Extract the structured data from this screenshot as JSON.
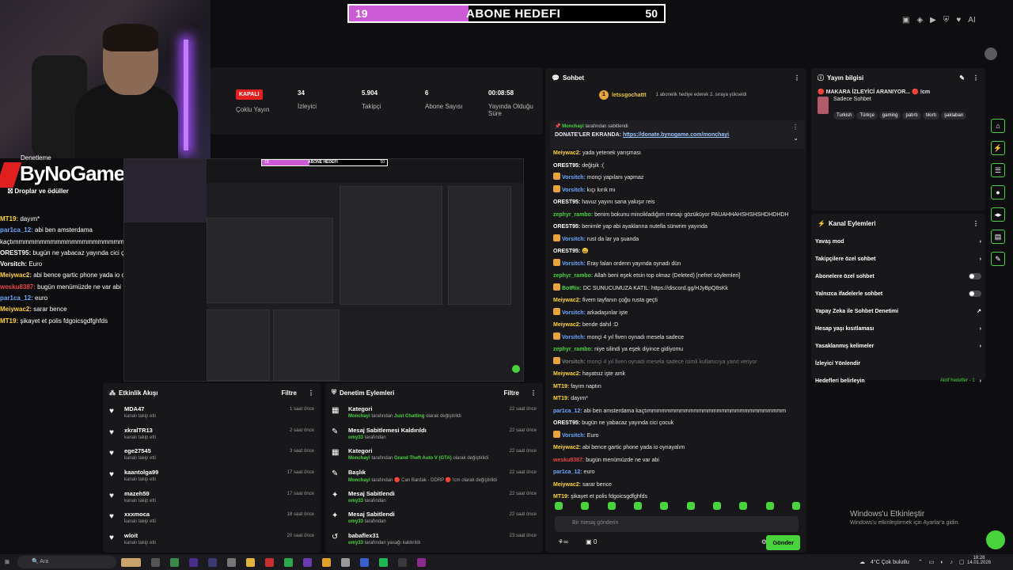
{
  "goal_bar": {
    "left": "19",
    "title": "ABONE HEDEFI",
    "right": "50",
    "progress": 0.38
  },
  "stream_overlay": {
    "brand": "ByNoGame",
    "brand_sub": "Droplar ve ödüller",
    "brand_top": "Denetleme",
    "chat": [
      {
        "user": "MT19:",
        "text": "dayım*",
        "color": "#ffd23c"
      },
      {
        "user": "par1ca_12:",
        "text": "abi ben amsterdama kaçtımmmmmmmmmmmmmmmmmmmmmmmmmmmmmmm",
        "color": "#6aa8ff"
      },
      {
        "user": "OREST95:",
        "text": "bugün ne yabacaz yayında cici çocuk",
        "color": "#ffffff"
      },
      {
        "user": "Vorsitch:",
        "text": "Euro",
        "color": "#ffffff"
      },
      {
        "user": "Meiywac2:",
        "text": "abi bence gartic phone yada io oynayalım",
        "color": "#ffd23c"
      },
      {
        "user": "wesku8387:",
        "text": "bugün menümüzde ne var abi",
        "color": "#e84545"
      },
      {
        "user": "par1ca_12:",
        "text": "euro",
        "color": "#6aa8ff"
      },
      {
        "user": "Meiywac2:",
        "text": "sarar bence",
        "color": "#ffd23c"
      },
      {
        "user": "MT19:",
        "text": "şikayet et polis fdgoicsgdfghfds",
        "color": "#ffd23c"
      }
    ]
  },
  "stats": {
    "status": "KAPALI",
    "status_label": "Çoklu Yayın",
    "viewers": "34",
    "viewers_label": "İzleyici",
    "followers": "5.904",
    "followers_label": "Takipçi",
    "subs": "6",
    "subs_label": "Abone Sayısı",
    "duration": "00:08:58",
    "duration_label": "Yayında Olduğu Süre"
  },
  "preview": {
    "goal_left": "19",
    "goal_title": "ABONE HEDEFI",
    "goal_right": "50"
  },
  "activity": {
    "title": "Etkinlik Akışı",
    "filter": "Filtre",
    "items": [
      {
        "name": "MDA47",
        "sub": "kanalı takip etti",
        "time": "1 saat önce"
      },
      {
        "name": "xkralTR13",
        "sub": "kanalı takip etti",
        "time": "2 saat önce"
      },
      {
        "name": "ege27545",
        "sub": "kanalı takip etti",
        "time": "3 saat önce"
      },
      {
        "name": "kaantolga99",
        "sub": "kanalı takip etti",
        "time": "17 saat önce"
      },
      {
        "name": "mazeh59",
        "sub": "kanalı takip etti",
        "time": "17 saat önce"
      },
      {
        "name": "xxxmoca",
        "sub": "kanalı takip etti",
        "time": "18 saat önce"
      },
      {
        "name": "wloit",
        "sub": "kanalı takip etti",
        "time": "20 saat önce"
      }
    ]
  },
  "modactions": {
    "title": "Denetim Eylemleri",
    "filter": "Filtre",
    "items": [
      {
        "icon": "▦",
        "name": "Kategori",
        "sub_user": "Monchayi",
        "sub_text": "tarafından",
        "sub_hl": "Just Chatting",
        "sub_end": "olarak değiştirildi",
        "time": "22 saat önce"
      },
      {
        "icon": "✎",
        "name": "Mesaj Sabitlemesi Kaldırıldı",
        "sub_user": "omy33",
        "sub_text": "tarafından",
        "sub_hl": "",
        "sub_end": "",
        "time": "22 saat önce"
      },
      {
        "icon": "▦",
        "name": "Kategori",
        "sub_user": "Monchayi",
        "sub_text": "tarafından",
        "sub_hl": "Grand Theft Auto V (GTA)",
        "sub_end": "olarak değiştirildi",
        "time": "22 saat önce"
      },
      {
        "icon": "✎",
        "name": "Başlık",
        "sub_user": "Monchayi",
        "sub_text": "tarafından 🔴 Can Bardak - DDRP 🔴 !cm",
        "sub_hl": "",
        "sub_end": "olarak değiştirildi",
        "time": "22 saat önce"
      },
      {
        "icon": "✦",
        "name": "Mesaj Sabitlendi",
        "sub_user": "omy33",
        "sub_text": "tarafından",
        "sub_hl": "",
        "sub_end": "",
        "time": "22 saat önce"
      },
      {
        "icon": "✦",
        "name": "Mesaj Sabitlendi",
        "sub_user": "omy33",
        "sub_text": "tarafından",
        "sub_hl": "",
        "sub_end": "",
        "time": "22 saat önce"
      },
      {
        "icon": "↺",
        "name": "babaflex31",
        "sub_user": "omy33",
        "sub_text": "tarafından yasağı kaldırıldı",
        "sub_hl": "",
        "sub_end": "",
        "time": "23 saat önce"
      }
    ]
  },
  "chat": {
    "title": "Sohbet",
    "gift_user": "letssgochattt",
    "gift_text": "1 abonelik hediye ederek 2. sıraya yükseldi",
    "pinned_by": "Monchayi",
    "pinned_by_text": "tarafından sabitlendi",
    "pinned_prefix": "DONATE'LER EKRANDA:",
    "pinned_link": "https://donate.bynogame.com/monchayi",
    "messages": [
      {
        "user": "Meiywac2:",
        "text": "yada yetenek yarışması",
        "color": "#ffd23c"
      },
      {
        "user": "OREST95:",
        "text": "değişik :(",
        "color": "#ffffff"
      },
      {
        "user": "Vorsitch:",
        "text": "monçi yapılanı yapmaz",
        "color": "#6aa8ff"
      },
      {
        "user": "Vorsitch:",
        "text": "kıçı kırık mı",
        "color": "#6aa8ff"
      },
      {
        "user": "OREST95:",
        "text": "havuz yayını sana yakışır reis",
        "color": "#ffffff"
      },
      {
        "user": "zephyr_rambo:",
        "text": "benim bokunu mincikladığım mesajı gözüküyor PAUAHHAHSHSHSHDHDHDH",
        "color": "#49d33d"
      },
      {
        "user": "OREST95:",
        "text": "benimle yap abi ayaklarına nutella sürwrim yayında",
        "color": "#ffffff"
      },
      {
        "user": "Vorsitch:",
        "text": "rust da lar ya şuanda",
        "color": "#6aa8ff"
      },
      {
        "user": "OREST95:",
        "text": "😀",
        "color": "#ffffff"
      },
      {
        "user": "Vorsitch:",
        "text": "Eray falan ordenn yayında oynadı dün",
        "color": "#6aa8ff"
      },
      {
        "user": "zephyr_rambo:",
        "text": "Allah beni eşek etsin top olmaz (Deleted) [nefret söylemleri]",
        "color": "#49d33d"
      },
      {
        "user": "BotRix:",
        "text": "DC SUNUCUMUZA KATIL: https://discord.gg/HJyBpQ8sKk",
        "color": "#49d33d"
      },
      {
        "user": "Meiywac2:",
        "text": "fivem tayfanın çoğu rusta geçti",
        "color": "#ffd23c"
      },
      {
        "user": "Vorsitch:",
        "text": "arkadaşınlar işte",
        "color": "#6aa8ff"
      },
      {
        "user": "Meiywac2:",
        "text": "bende dahil :D",
        "color": "#ffd23c"
      },
      {
        "user": "Vorsitch:",
        "text": "monçi 4 yıl fiven oynadı mesela sadece",
        "color": "#6aa8ff"
      },
      {
        "user": "zephyr_rambo:",
        "text": "niye silindi ya eşek diyince gidiyomu",
        "color": "#49d33d"
      },
      {
        "user": "Vorsitch:",
        "text": "monçi 4 yıl fiven oynadı mesela sadece isimli kullanıcıya yanıt veriyor",
        "color": "#777777"
      },
      {
        "user": "Meiywac2:",
        "text": "hayatsız işte amk",
        "color": "#ffd23c"
      },
      {
        "user": "MT19:",
        "text": "fayım naptın",
        "color": "#ffd23c"
      },
      {
        "user": "MT19:",
        "text": "dayım*",
        "color": "#ffd23c"
      },
      {
        "user": "par1ca_12:",
        "text": "abi ben amsterdama kaçtımmmmmmmmmmmmmmmmmmmmmmmmmmmmmm",
        "color": "#6aa8ff"
      },
      {
        "user": "OREST95:",
        "text": "bugün ne yabacaz yayında cici çocuk",
        "color": "#ffffff"
      },
      {
        "user": "Vorsitch:",
        "text": "Euro",
        "color": "#6aa8ff"
      },
      {
        "user": "Meiywac2:",
        "text": "abi bence gartic phone yada io oynayalım",
        "color": "#ffd23c"
      },
      {
        "user": "wesku8387:",
        "text": "bugün menümüzde ne var abi",
        "color": "#e84545"
      },
      {
        "user": "par1ca_12:",
        "text": "euro",
        "color": "#6aa8ff"
      },
      {
        "user": "Meiywac2:",
        "text": "sarar bence",
        "color": "#ffd23c"
      },
      {
        "user": "MT19:",
        "text": "şikayet et polis fdgoicsgdfghfds",
        "color": "#ffd23c"
      }
    ],
    "input_placeholder": "Bir mesaj gönderin",
    "send": "Gönder",
    "points": "0"
  },
  "info": {
    "title": "Yayın bilgisi",
    "stream_title": "🔴 MAKARA İZLEYİCİ ARANIYOR... 🔴 !cm",
    "category": "Sadece Sohbet",
    "tags": [
      "Turkish",
      "Türkçe",
      "gaming",
      "patırtı",
      "tıkırtı",
      "şaklaban"
    ]
  },
  "actions": {
    "title": "Kanal Eylemleri",
    "items": [
      {
        "label": "Yavaş mod",
        "ctrl": "chevron"
      },
      {
        "label": "Takipçilere özel sohbet",
        "ctrl": "chevron"
      },
      {
        "label": "Abonelere özel sohbet",
        "ctrl": "toggle"
      },
      {
        "label": "Yalnızca ifadelerle sohbet",
        "ctrl": "toggle"
      },
      {
        "label": "Yapay Zeka ile Sohbet Denetimi",
        "ctrl": "link"
      },
      {
        "label": "Hesap yaşı kısıtlaması",
        "ctrl": "chevron"
      },
      {
        "label": "Yasaklanmış kelimeler",
        "ctrl": "chevron"
      },
      {
        "label": "İzleyici Yönlendir",
        "ctrl": "none"
      },
      {
        "label": "Hedefleri belirleyin",
        "ctrl": "chevron"
      }
    ],
    "goals_status": "Aktif hedefler - 1"
  },
  "windows": {
    "line1": "Windows'u Etkinleştir",
    "line2": "Windows'u etkinleştirmek için Ayarlar'a gidin."
  },
  "taskbar": {
    "search": "Ara",
    "weather": "4°C Çok bulutlu",
    "time": "18:28",
    "date": "14.01.2026"
  }
}
